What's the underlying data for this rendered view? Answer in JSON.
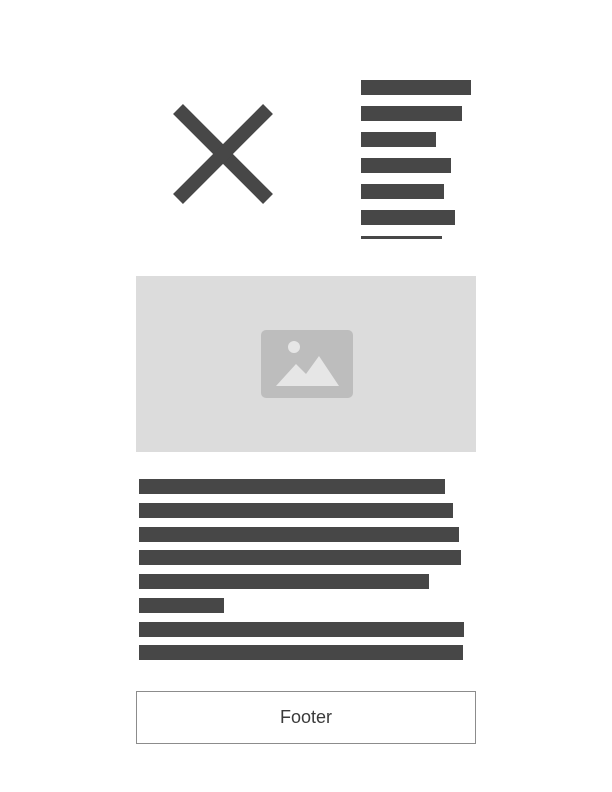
{
  "header": {
    "close_icon": "close-icon",
    "text_block": {
      "line_count": 7,
      "line_color": "#474747"
    }
  },
  "hero": {
    "icon": "image-icon",
    "background_color": "#dcdcdc",
    "icon_color": "#bdbdbd"
  },
  "content": {
    "line_count": 8,
    "line_color": "#474747"
  },
  "footer": {
    "label": "Footer",
    "border_color": "#8c8c8c"
  }
}
